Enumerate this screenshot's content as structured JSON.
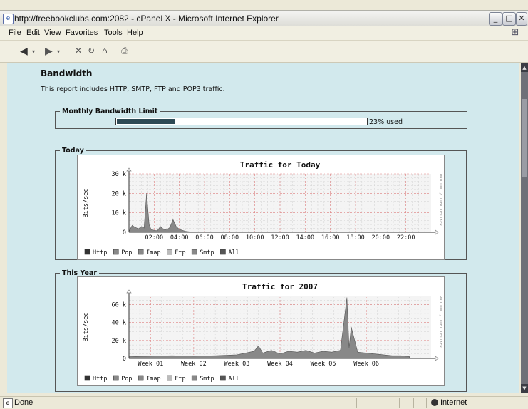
{
  "window": {
    "title": "http://freebookclubs.com:2082 - cPanel X - Microsoft Internet Explorer",
    "buttons": {
      "minimize": "_",
      "maximize": "□",
      "close": "✕"
    }
  },
  "menubar": [
    "File",
    "Edit",
    "View",
    "Favorites",
    "Tools",
    "Help"
  ],
  "page": {
    "heading": "Bandwidth",
    "description": "This report includes HTTP, SMTP, FTP and POP3 traffic.",
    "bandwidth_limit": {
      "legend": "Monthly Bandwidth Limit",
      "used_fraction": 0.23,
      "used_text": "23% used"
    },
    "today_section": {
      "legend": "Today"
    },
    "year_section": {
      "legend": "This Year"
    }
  },
  "chart_data": [
    {
      "type": "area",
      "title": "Traffic for Today",
      "ylabel": "Bits/sec",
      "side_label": "RRDTOOL / TOBI OETIKER",
      "ylim": [
        0,
        30000
      ],
      "yticks": [
        "0",
        "10 k",
        "20 k",
        "30 k"
      ],
      "xticks": [
        "02:00",
        "04:00",
        "06:00",
        "08:00",
        "10:00",
        "12:00",
        "14:00",
        "16:00",
        "18:00",
        "20:00",
        "22:00"
      ],
      "grid": true,
      "legend": [
        "Http",
        "Pop",
        "Imap",
        "Ftp",
        "Smtp",
        "All"
      ],
      "x_hours": [
        0,
        0.25,
        0.5,
        0.75,
        1.0,
        1.2,
        1.4,
        1.6,
        1.75,
        2.0,
        2.25,
        2.5,
        2.75,
        3.0,
        3.25,
        3.5,
        3.75,
        4.0,
        4.25,
        4.5,
        4.75,
        5.0
      ],
      "values": [
        500,
        3500,
        2500,
        1800,
        3000,
        2200,
        20000,
        4000,
        1500,
        1000,
        800,
        3000,
        1500,
        1200,
        2500,
        6500,
        3000,
        1500,
        1000,
        500,
        300,
        0
      ]
    },
    {
      "type": "area",
      "title": "Traffic for 2007",
      "ylabel": "Bits/sec",
      "side_label": "RRDTOOL / TOBI OETIKER",
      "ylim": [
        0,
        70000
      ],
      "yticks": [
        "0",
        "20 k",
        "40 k",
        "60 k"
      ],
      "xticks": [
        "Week 01",
        "Week 02",
        "Week 03",
        "Week 04",
        "Week 05",
        "Week 06"
      ],
      "grid": true,
      "legend": [
        "Http",
        "Pop",
        "Imap",
        "Ftp",
        "Smtp",
        "All"
      ],
      "x_weeks": [
        0,
        0.5,
        1.0,
        1.5,
        2.0,
        2.5,
        2.7,
        2.9,
        3.0,
        3.1,
        3.3,
        3.5,
        3.7,
        3.9,
        4.1,
        4.3,
        4.5,
        4.7,
        4.9,
        5.05,
        5.1,
        5.15,
        5.3,
        5.5,
        5.7,
        5.9,
        6.1,
        6.3,
        6.5
      ],
      "values": [
        2000,
        2500,
        3000,
        2500,
        3000,
        4000,
        6000,
        8000,
        14000,
        6000,
        9000,
        5000,
        8000,
        7000,
        9000,
        6000,
        8000,
        7000,
        9000,
        68000,
        12000,
        35000,
        7000,
        6000,
        5000,
        4000,
        3000,
        3000,
        2000
      ]
    }
  ],
  "statusbar": {
    "text": "Done",
    "zone": "Internet"
  }
}
